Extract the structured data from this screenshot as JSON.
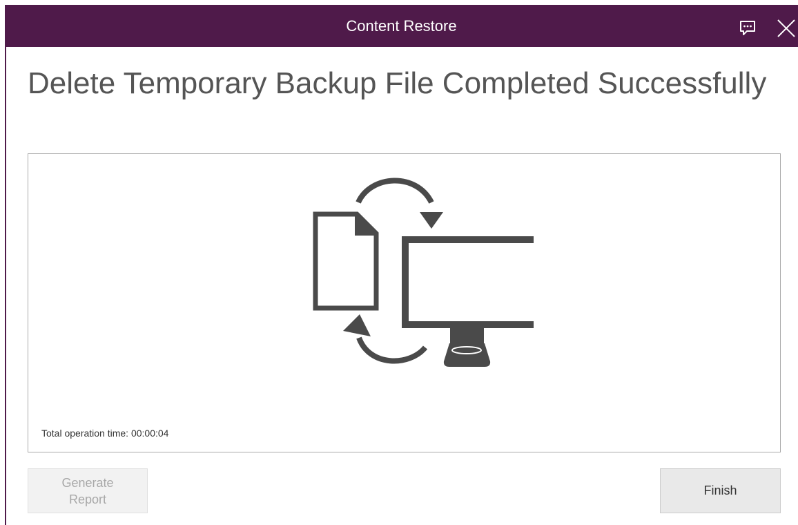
{
  "window": {
    "title": "Content Restore",
    "accent_color": "#4f1a4a"
  },
  "icons": {
    "feedback": "feedback-icon",
    "close": "close-icon",
    "illustration": "restore-illustration-icon"
  },
  "main": {
    "heading": "Delete Temporary Backup File Completed Successfully",
    "operation_time": "Total operation time: 00:00:04"
  },
  "buttons": {
    "generate_report_label": "Generate\nReport",
    "generate_report_enabled": false,
    "finish_label": "Finish"
  }
}
